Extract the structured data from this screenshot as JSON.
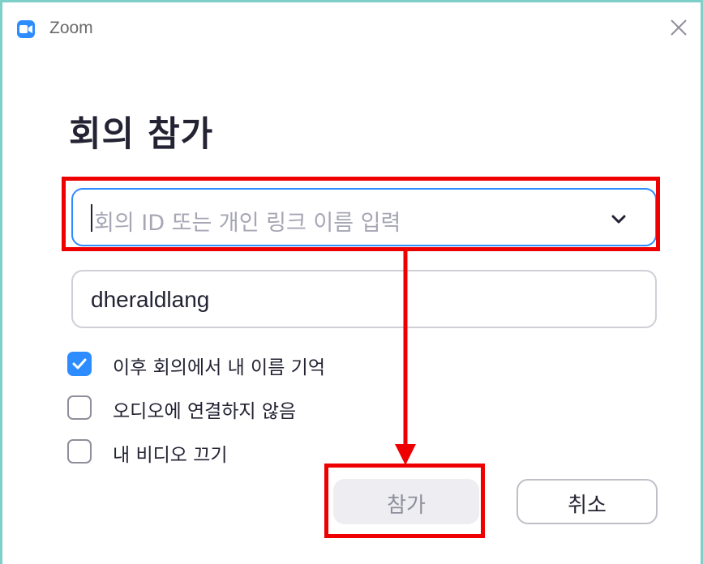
{
  "window": {
    "title": "Zoom"
  },
  "dialog": {
    "heading": "회의 참가",
    "meeting_id_input": {
      "placeholder": "회의 ID 또는 개인 링크 이름 입력",
      "value": ""
    },
    "name_input": {
      "value": "dheraldlang"
    },
    "options": [
      {
        "label": "이후 회의에서 내 이름 기억",
        "checked": true
      },
      {
        "label": "오디오에 연결하지 않음",
        "checked": false
      },
      {
        "label": "내 비디오 끄기",
        "checked": false
      }
    ],
    "join_label": "참가",
    "cancel_label": "취소"
  },
  "colors": {
    "accent": "#2d8cff",
    "highlight": "#ee0000",
    "frame": "#7ecfc8"
  },
  "icons": {
    "app": "zoom-camera-icon",
    "close": "close-icon",
    "dropdown": "chevron-down-icon",
    "check": "checkmark-icon"
  }
}
